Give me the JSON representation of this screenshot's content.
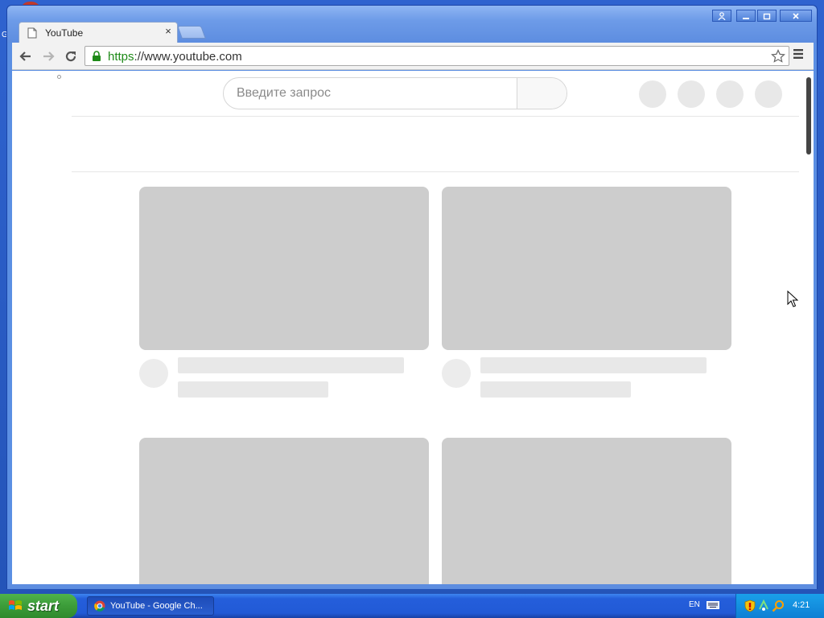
{
  "desktop": {
    "edge_text": "G"
  },
  "tab": {
    "title": "YouTube",
    "close_glyph": "×"
  },
  "address_bar": {
    "scheme": "https",
    "rest": "://www.youtube.com"
  },
  "page": {
    "search": {
      "placeholder": "Введите запрос"
    },
    "header_buttons_count": 4,
    "video_cards_count": 4
  },
  "taskbar": {
    "start_label": "start",
    "task_item": "YouTube - Google Ch...",
    "language": "EN",
    "clock": "4:21"
  },
  "colors": {
    "scheme_green": "#1e8a18",
    "skeleton": "#cdcdcd",
    "taskbar_blue": "#245edb",
    "start_green": "#3c9c39"
  }
}
